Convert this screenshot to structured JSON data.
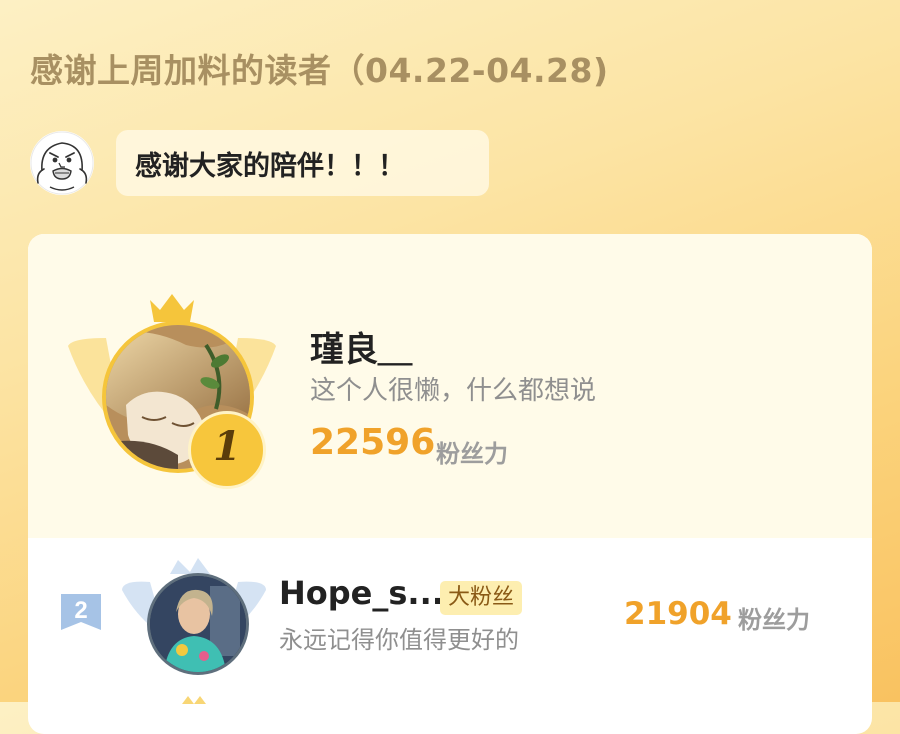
{
  "header": {
    "title": "感谢上周加料的读者（04.22-04.28)"
  },
  "banter": {
    "avatar_icon": "rage-comic-face-icon",
    "message": "感谢大家的陪伴！！！"
  },
  "ranking": {
    "top": {
      "rank": "1",
      "name": "瑾良＿",
      "bio": "这个人很懒，什么都想说",
      "score": "22596",
      "unit": "粉丝力",
      "frame_icons": [
        "crown-icon",
        "wings-icon"
      ]
    },
    "entries": [
      {
        "rank": "2",
        "name": "Hope_s...",
        "badge": "大粉丝",
        "bio": "永远记得你值得更好的",
        "score": "21904",
        "unit": "粉丝力"
      }
    ]
  },
  "colors": {
    "accent": "#f0a22a",
    "gold": "#f7c63c",
    "title": "#a89062",
    "silver": "#a6c3e6"
  }
}
